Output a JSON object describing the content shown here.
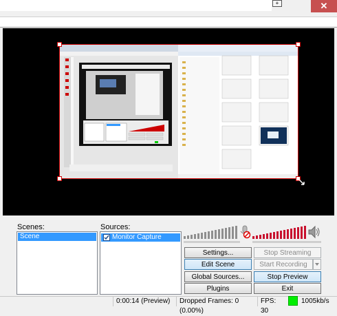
{
  "scenes": {
    "label": "Scenes:",
    "items": [
      "Scene"
    ]
  },
  "sources": {
    "label": "Sources:",
    "items": [
      {
        "label": "Monitor Capture",
        "checked": true
      }
    ]
  },
  "buttons": {
    "settings": "Settings...",
    "stop_streaming": "Stop Streaming",
    "edit_scene": "Edit Scene",
    "start_recording": "Start Recording",
    "global_sources": "Global Sources...",
    "stop_preview": "Stop Preview",
    "plugins": "Plugins",
    "exit": "Exit"
  },
  "status": {
    "time": "0:00:14 (Preview)",
    "dropped_frames": "Dropped Frames: 0 (0.00%)",
    "fps": "FPS: 30",
    "bitrate": "1005kb/s",
    "bitrate_indicator_color": "#00ee00"
  },
  "colors": {
    "selection": "#3399ff",
    "capture_border": "#cc0000"
  }
}
